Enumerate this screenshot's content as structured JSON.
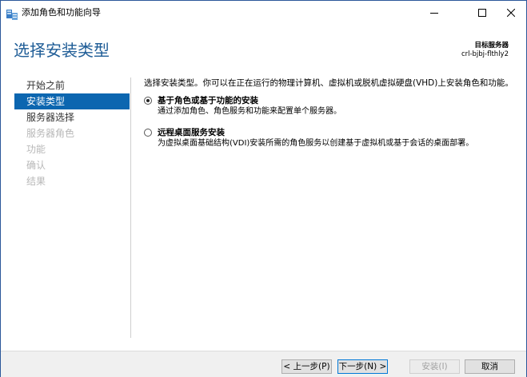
{
  "window": {
    "title": "添加角色和功能向导",
    "icon": "server-manager-icon"
  },
  "header": {
    "page_title": "选择安装类型",
    "destination_label": "目标服务器",
    "destination_server": "crl-bjbj-flthly2"
  },
  "nav": {
    "items": [
      {
        "label": "开始之前",
        "state": "normal"
      },
      {
        "label": "安装类型",
        "state": "active"
      },
      {
        "label": "服务器选择",
        "state": "normal"
      },
      {
        "label": "服务器角色",
        "state": "disabled"
      },
      {
        "label": "功能",
        "state": "disabled"
      },
      {
        "label": "确认",
        "state": "disabled"
      },
      {
        "label": "结果",
        "state": "disabled"
      }
    ]
  },
  "content": {
    "intro": "选择安装类型。你可以在正在运行的物理计算机、虚拟机或脱机虚拟硬盘(VHD)上安装角色和功能。",
    "options": [
      {
        "title": "基于角色或基于功能的安装",
        "description": "通过添加角色、角色服务和功能来配置单个服务器。",
        "checked": true
      },
      {
        "title": "远程桌面服务安装",
        "description": "为虚拟桌面基础结构(VDI)安装所需的角色服务以创建基于虚拟机或基于会话的桌面部署。",
        "checked": false
      }
    ]
  },
  "footer": {
    "prev_label": "< 上一步(P)",
    "next_label": "下一步(N) >",
    "install_label": "安装(I)",
    "cancel_label": "取消"
  },
  "colors": {
    "accent": "#0c66b0",
    "title_blue": "#1e5c96"
  }
}
